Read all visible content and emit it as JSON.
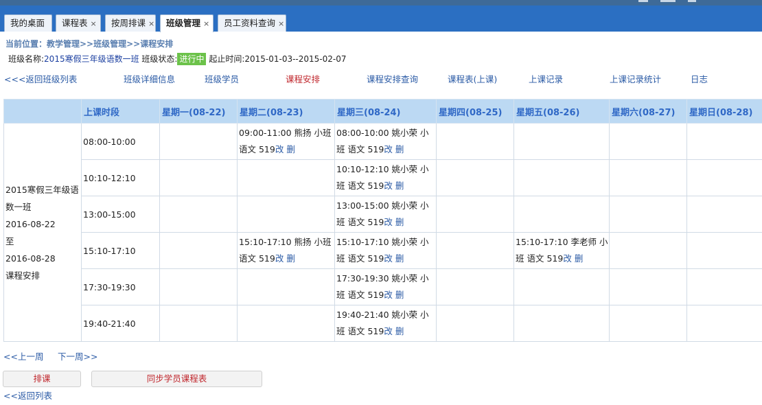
{
  "tabs": [
    {
      "label": "我的桌面",
      "closable": false,
      "active": false
    },
    {
      "label": "课程表",
      "closable": true,
      "active": false
    },
    {
      "label": "按周排课",
      "closable": true,
      "active": false
    },
    {
      "label": "班级管理",
      "closable": true,
      "active": true
    },
    {
      "label": "员工资料查询",
      "closable": true,
      "active": false
    }
  ],
  "tab_close_glyph": "×",
  "breadcrumb": "当前位置：教学管理>>班级管理>>课程安排",
  "class_info": {
    "name_label": "班级名称:",
    "name": "2015寒假三年级语数一班",
    "status_label": "班级状态:",
    "status": "进行中",
    "period_label": "起止时间:",
    "period": "2015-01-03--2015-02-07"
  },
  "nav_links": [
    {
      "label": "<<<返回班级列表",
      "current": false
    },
    {
      "label": "班级详细信息",
      "current": false
    },
    {
      "label": "班级学员",
      "current": false
    },
    {
      "label": "课程安排",
      "current": true
    },
    {
      "label": "课程安排查询",
      "current": false
    },
    {
      "label": "课程表(上课)",
      "current": false
    },
    {
      "label": "上课记录",
      "current": false
    },
    {
      "label": "上课记录统计",
      "current": false
    },
    {
      "label": "日志",
      "current": false
    }
  ],
  "schedule": {
    "headers": [
      "",
      "上课时段",
      "星期一(08-22)",
      "星期二(08-23)",
      "星期三(08-24)",
      "星期四(08-25)",
      "星期五(08-26)",
      "星期六(08-27)",
      "星期日(08-28)"
    ],
    "class_cell": [
      "2015寒假三年级语",
      "数一班",
      "2016-08-22",
      "至",
      "2016-08-28",
      "课程安排"
    ],
    "rows": [
      {
        "time": "08:00-10:00",
        "cells": [
          "",
          "09:00-11:00 熊扬 小班 语文 519",
          "08:00-10:00 姚小荣 小班 语文 519",
          "",
          "",
          "",
          ""
        ]
      },
      {
        "time": "10:10-12:10",
        "cells": [
          "",
          "",
          "10:10-12:10 姚小荣 小班 语文 519",
          "",
          "",
          "",
          ""
        ]
      },
      {
        "time": "13:00-15:00",
        "cells": [
          "",
          "",
          "13:00-15:00 姚小荣 小班 语文 519",
          "",
          "",
          "",
          ""
        ]
      },
      {
        "time": "15:10-17:10",
        "cells": [
          "",
          "15:10-17:10 熊扬 小班 语文 519",
          "15:10-17:10 姚小荣 小班 语文 519",
          "",
          "15:10-17:10 李老师 小班 语文 519",
          "",
          ""
        ]
      },
      {
        "time": "17:30-19:30",
        "cells": [
          "",
          "",
          "17:30-19:30 姚小荣 小班 语文 519",
          "",
          "",
          "",
          ""
        ]
      },
      {
        "time": "19:40-21:40",
        "cells": [
          "",
          "",
          "19:40-21:40 姚小荣 小班 语文 519",
          "",
          "",
          "",
          ""
        ]
      }
    ],
    "edit_label": "改",
    "delete_label": "删"
  },
  "week_nav": {
    "prev": "<<上一周",
    "next": "下一周>>"
  },
  "buttons": {
    "schedule": "排课",
    "sync": "同步学员课程表"
  },
  "back_list": "<<返回列表"
}
